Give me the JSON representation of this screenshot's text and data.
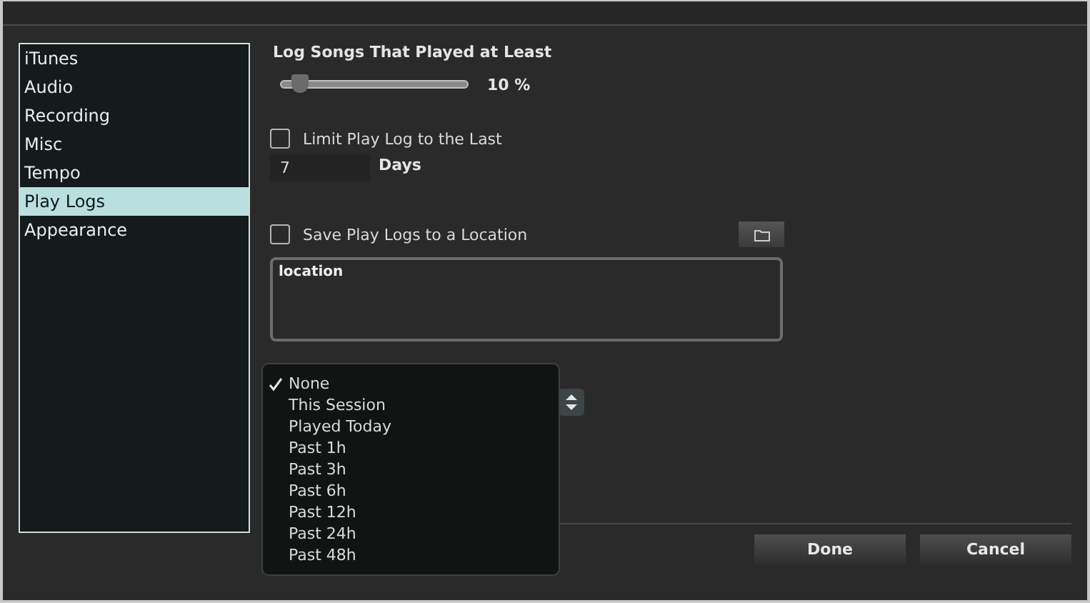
{
  "sidebar": {
    "items": [
      {
        "label": "iTunes",
        "selected": false
      },
      {
        "label": "Audio",
        "selected": false
      },
      {
        "label": "Recording",
        "selected": false
      },
      {
        "label": "Misc",
        "selected": false
      },
      {
        "label": "Tempo",
        "selected": false
      },
      {
        "label": "Play Logs",
        "selected": true
      },
      {
        "label": "Appearance",
        "selected": false
      }
    ]
  },
  "play_threshold": {
    "title": "Log Songs That Played at Least",
    "level": 0.1,
    "reading": "10 %"
  },
  "limit_play_log": {
    "label": "Limit Play Log to the Last",
    "checked": false,
    "days": "7",
    "unit": "Days"
  },
  "save_play_logs": {
    "label": "Save Play Logs to a Location",
    "checked": false,
    "placeholder": "location"
  },
  "mark_songs_menu": {
    "items": [
      {
        "label": "None",
        "checked": true
      },
      {
        "label": "This Session",
        "checked": false
      },
      {
        "label": "Played Today",
        "checked": false
      },
      {
        "label": "Past 1h",
        "checked": false
      },
      {
        "label": "Past 3h",
        "checked": false
      },
      {
        "label": "Past 6h",
        "checked": false
      },
      {
        "label": "Past 12h",
        "checked": false
      },
      {
        "label": "Past 24h",
        "checked": false
      },
      {
        "label": "Past 48h",
        "checked": false
      }
    ]
  },
  "buttons": [
    {
      "label": "Done"
    },
    {
      "label": "Cancel"
    }
  ]
}
